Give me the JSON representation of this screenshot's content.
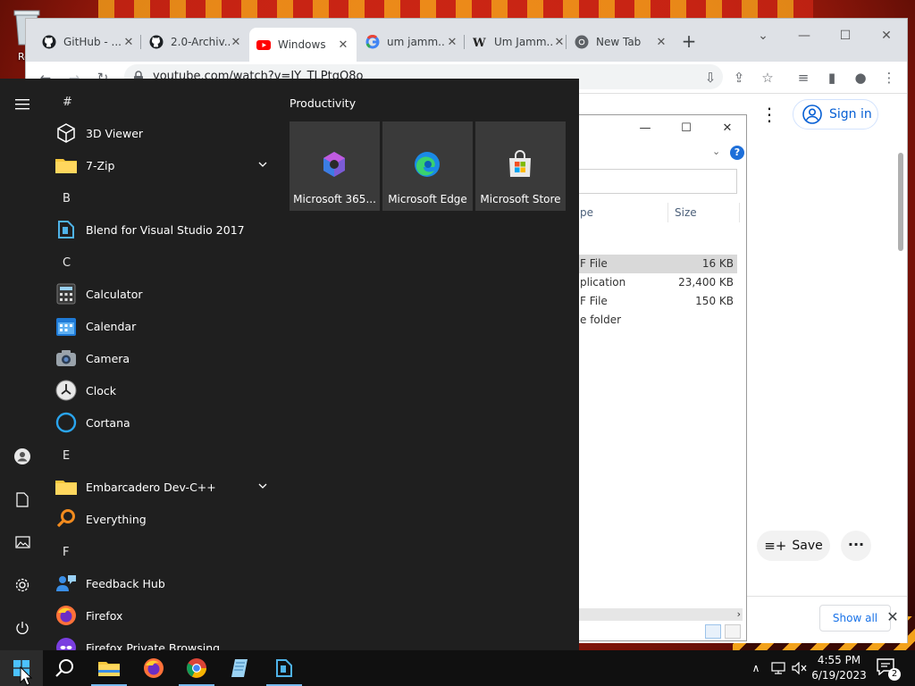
{
  "desktop": {
    "recycle_label": "Rec"
  },
  "chrome": {
    "tabs": [
      {
        "title": "GitHub - ...",
        "icon": "github-icon"
      },
      {
        "title": "2.0-Archiv...",
        "icon": "github-icon"
      },
      {
        "title": "Windows",
        "icon": "youtube-icon"
      },
      {
        "title": "um jamm...",
        "icon": "google-icon"
      },
      {
        "title": "Um Jamm...",
        "icon": "wikipedia-icon"
      },
      {
        "title": "New Tab",
        "icon": "chrome-icon"
      }
    ],
    "url": "youtube.com/watch?v=IY_TLPtqO8o",
    "signin_label": "Sign in",
    "save_label": "Save",
    "show_all_label": "Show all"
  },
  "explorer": {
    "columns": {
      "type": "pe",
      "size": "Size"
    },
    "rows": [
      {
        "type": "F File",
        "size": "16 KB",
        "selected": true
      },
      {
        "type": "plication",
        "size": "23,400 KB",
        "selected": false
      },
      {
        "type": "F File",
        "size": "150 KB",
        "selected": false
      },
      {
        "type": "e folder",
        "size": "",
        "selected": false
      }
    ]
  },
  "start_menu": {
    "letters": [
      "#",
      "B",
      "C",
      "E",
      "F"
    ],
    "apps": [
      {
        "label": "3D Viewer",
        "icon": "cube-icon"
      },
      {
        "label": "7-Zip",
        "icon": "folder-icon",
        "expandable": true
      },
      {
        "label": "Blend for Visual Studio 2017",
        "icon": "blend-icon"
      },
      {
        "label": "Calculator",
        "icon": "calculator-icon"
      },
      {
        "label": "Calendar",
        "icon": "calendar-icon"
      },
      {
        "label": "Camera",
        "icon": "camera-icon"
      },
      {
        "label": "Clock",
        "icon": "clock-icon"
      },
      {
        "label": "Cortana",
        "icon": "cortana-icon"
      },
      {
        "label": "Embarcadero Dev-C++",
        "icon": "folder-icon",
        "expandable": true
      },
      {
        "label": "Everything",
        "icon": "magnifier-icon"
      },
      {
        "label": "Feedback Hub",
        "icon": "feedback-icon"
      },
      {
        "label": "Firefox",
        "icon": "firefox-icon"
      },
      {
        "label": "Firefox Private Browsing",
        "icon": "firefox-private-icon"
      }
    ],
    "group_title": "Productivity",
    "tiles": [
      {
        "label": "Microsoft 365...",
        "icon": "m365-icon"
      },
      {
        "label": "Microsoft Edge",
        "icon": "edge-icon"
      },
      {
        "label": "Microsoft Store",
        "icon": "store-icon"
      }
    ]
  },
  "taskbar": {
    "time": "4:55 PM",
    "date": "6/19/2023",
    "notification_count": "2"
  }
}
